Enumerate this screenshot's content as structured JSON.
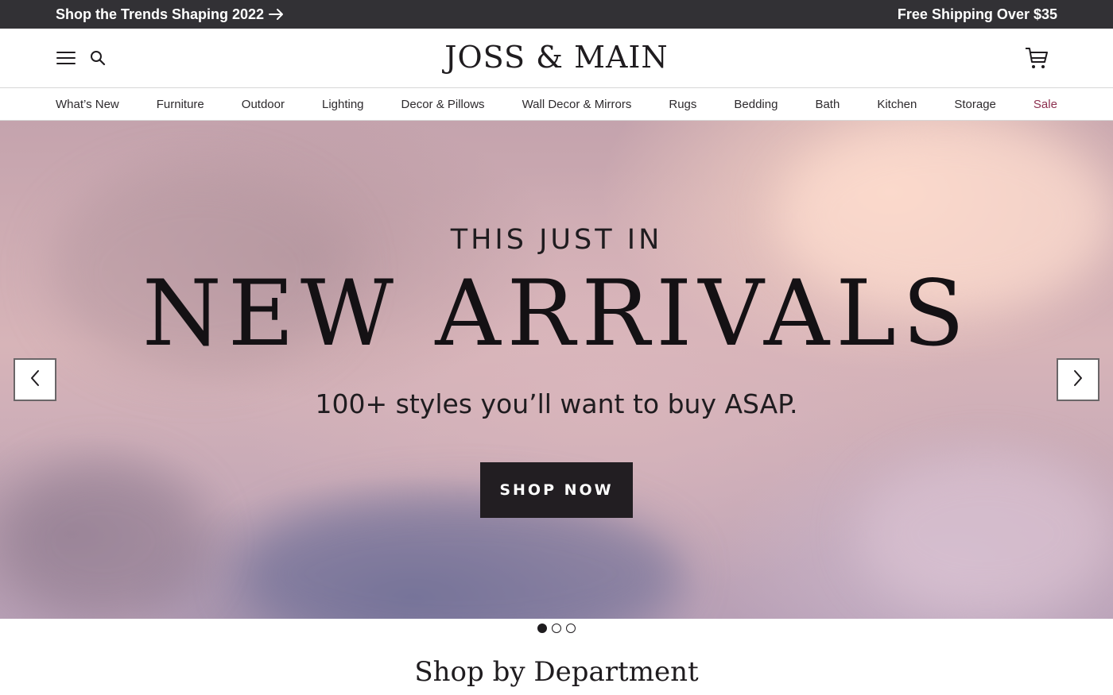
{
  "promo": {
    "left_text": "Shop the Trends Shaping 2022",
    "left_icon": "arrow-right-icon",
    "right_text": "Free Shipping Over $35"
  },
  "header": {
    "logo": "JOSS & MAIN",
    "menu_icon": "hamburger-menu-icon",
    "search_icon": "search-icon",
    "cart_icon": "cart-icon"
  },
  "nav": {
    "items": [
      {
        "label": "What’s New"
      },
      {
        "label": "Furniture"
      },
      {
        "label": "Outdoor"
      },
      {
        "label": "Lighting"
      },
      {
        "label": "Decor & Pillows"
      },
      {
        "label": "Wall Decor & Mirrors"
      },
      {
        "label": "Rugs"
      },
      {
        "label": "Bedding"
      },
      {
        "label": "Bath"
      },
      {
        "label": "Kitchen"
      },
      {
        "label": "Storage"
      },
      {
        "label": "Sale"
      }
    ],
    "sale_color": "#8c2f4e"
  },
  "hero": {
    "eyebrow": "THIS JUST IN",
    "headline": "NEW ARRIVALS",
    "subhead": "100+ styles you’ll want to buy ASAP.",
    "cta_label": "SHOP NOW",
    "prev_icon": "chevron-left-icon",
    "next_icon": "chevron-right-icon",
    "slide_count": 3,
    "active_slide": 1
  },
  "section": {
    "title": "Shop by Department"
  },
  "colors": {
    "promo_bg": "#323135",
    "cta_bg": "#221e22",
    "text": "#1f1c1f"
  }
}
